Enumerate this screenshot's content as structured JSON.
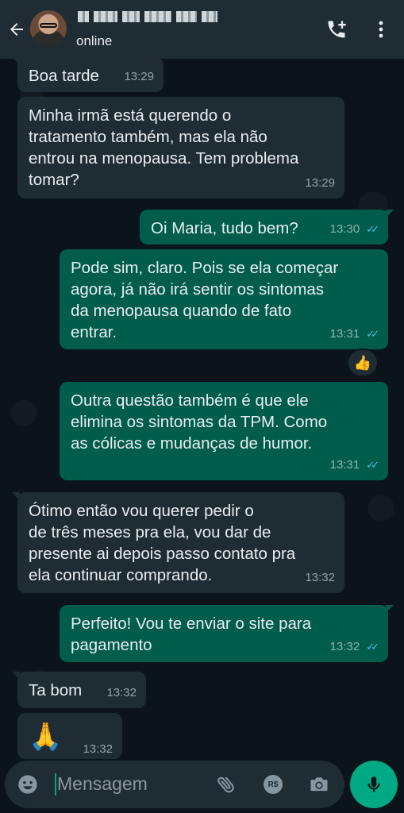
{
  "header": {
    "status": "online"
  },
  "messages": [
    {
      "text": "Boa tarde",
      "time": "13:29"
    },
    {
      "text": "Minha irmã está querendo o\ntratamento também, mas ela não\nentrou na menopausa. Tem problema\ntomar?",
      "time": "13:29"
    },
    {
      "text": "Oi Maria, tudo bem?",
      "time": "13:30"
    },
    {
      "text": "Pode sim, claro. Pois se ela começar\nagora, já não irá sentir os sintomas\nda menopausa quando de fato\nentrar.",
      "time": "13:31",
      "reaction": "👍"
    },
    {
      "text": "Outra questão também é que ele\nelimina os sintomas da TPM. Como\nas cólicas e mudanças de humor.",
      "time": "13:31"
    },
    {
      "text": "Ótimo então vou querer pedir o\nde três meses pra ela, vou dar de\npresente ai depois passo contato pra\nela continuar comprando.",
      "time": "13:32"
    },
    {
      "text": "Perfeito! Vou te enviar o site para\npagamento",
      "time": "13:32"
    },
    {
      "text": "Ta bom",
      "time": "13:32"
    },
    {
      "text": "🙏",
      "time": "13:32"
    }
  ],
  "composer": {
    "placeholder": "Mensagem",
    "rs_label": "R$"
  },
  "colors": {
    "background": "#0b141a",
    "header": "#1f2c34",
    "incoming": "#1f2c34",
    "outgoing": "#005c4b",
    "accent": "#00a884",
    "read_ticks": "#53bdeb"
  }
}
